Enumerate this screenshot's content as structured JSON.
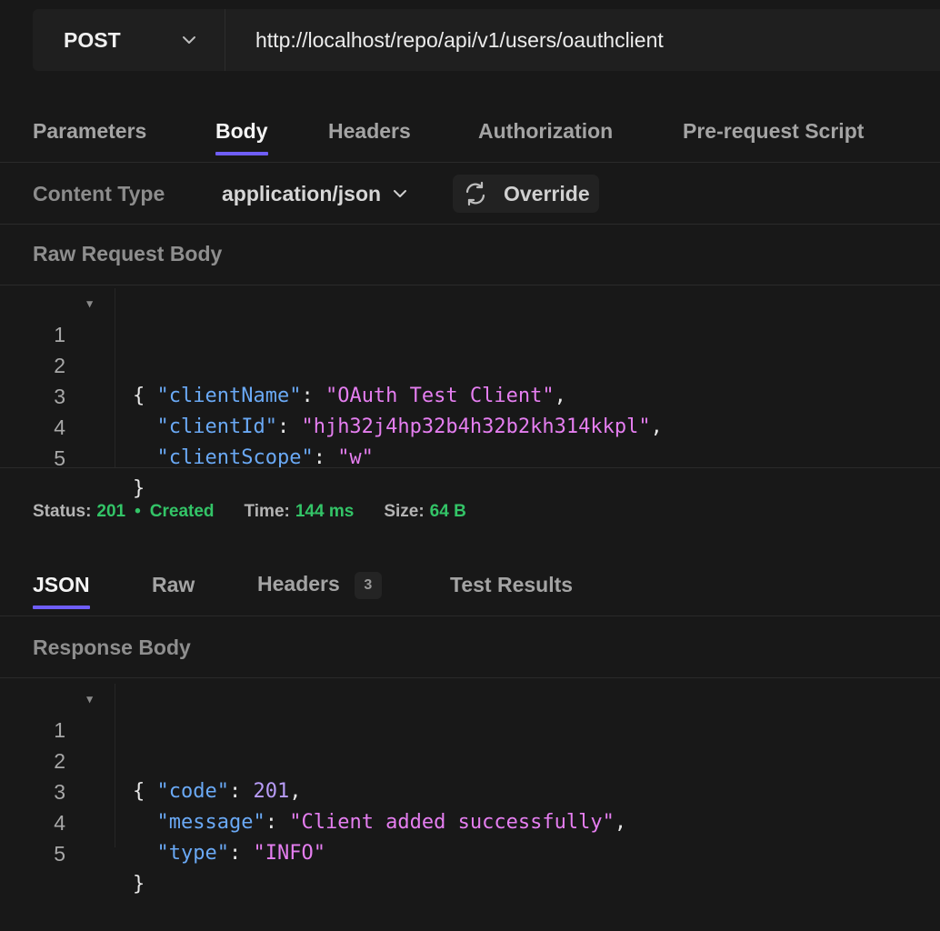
{
  "request": {
    "method": "POST",
    "url": "http://localhost/repo/api/v1/users/oauthclient"
  },
  "request_tabs": [
    {
      "label": "Parameters",
      "active": false
    },
    {
      "label": "Body",
      "active": true
    },
    {
      "label": "Headers",
      "active": false
    },
    {
      "label": "Authorization",
      "active": false
    },
    {
      "label": "Pre-request Script",
      "active": false
    }
  ],
  "content_type": {
    "label": "Content Type",
    "value": "application/json",
    "override_label": "Override"
  },
  "raw_request": {
    "label": "Raw Request Body",
    "lines": [
      {
        "n": "1",
        "fold": true
      },
      {
        "n": "2"
      },
      {
        "n": "3"
      },
      {
        "n": "4"
      },
      {
        "n": "5"
      }
    ],
    "tokens": {
      "l1": "{",
      "l2_key": "\"clientName\"",
      "l2_val": "\"OAuth Test Client\"",
      "l3_key": "\"clientId\"",
      "l3_val": "\"hjh32j4hp32b4h32b2kh314kkpl\"",
      "l4_key": "\"clientScope\"",
      "l4_val": "\"w\"",
      "l5": "}"
    }
  },
  "status_bar": {
    "status_label": "Status:",
    "status_code": "201",
    "status_text": "Created",
    "time_label": "Time:",
    "time_value": "144 ms",
    "size_label": "Size:",
    "size_value": "64 B"
  },
  "response_tabs": [
    {
      "label": "JSON",
      "active": true
    },
    {
      "label": "Raw",
      "active": false
    },
    {
      "label": "Headers",
      "active": false,
      "badge": "3"
    },
    {
      "label": "Test Results",
      "active": false
    }
  ],
  "response_body": {
    "label": "Response Body",
    "lines": [
      {
        "n": "1",
        "fold": true
      },
      {
        "n": "2"
      },
      {
        "n": "3"
      },
      {
        "n": "4"
      },
      {
        "n": "5"
      }
    ],
    "tokens": {
      "l1": "{",
      "l2_key": "\"code\"",
      "l2_val": "201",
      "l3_key": "\"message\"",
      "l3_val": "\"Client added successfully\"",
      "l4_key": "\"type\"",
      "l4_val": "\"INFO\"",
      "l5": "}"
    }
  },
  "colors": {
    "accent": "#6f5ef9",
    "success": "#33c467",
    "json_key": "#6aa9f5",
    "json_string": "#e57ef0",
    "json_number": "#b89cf7"
  }
}
